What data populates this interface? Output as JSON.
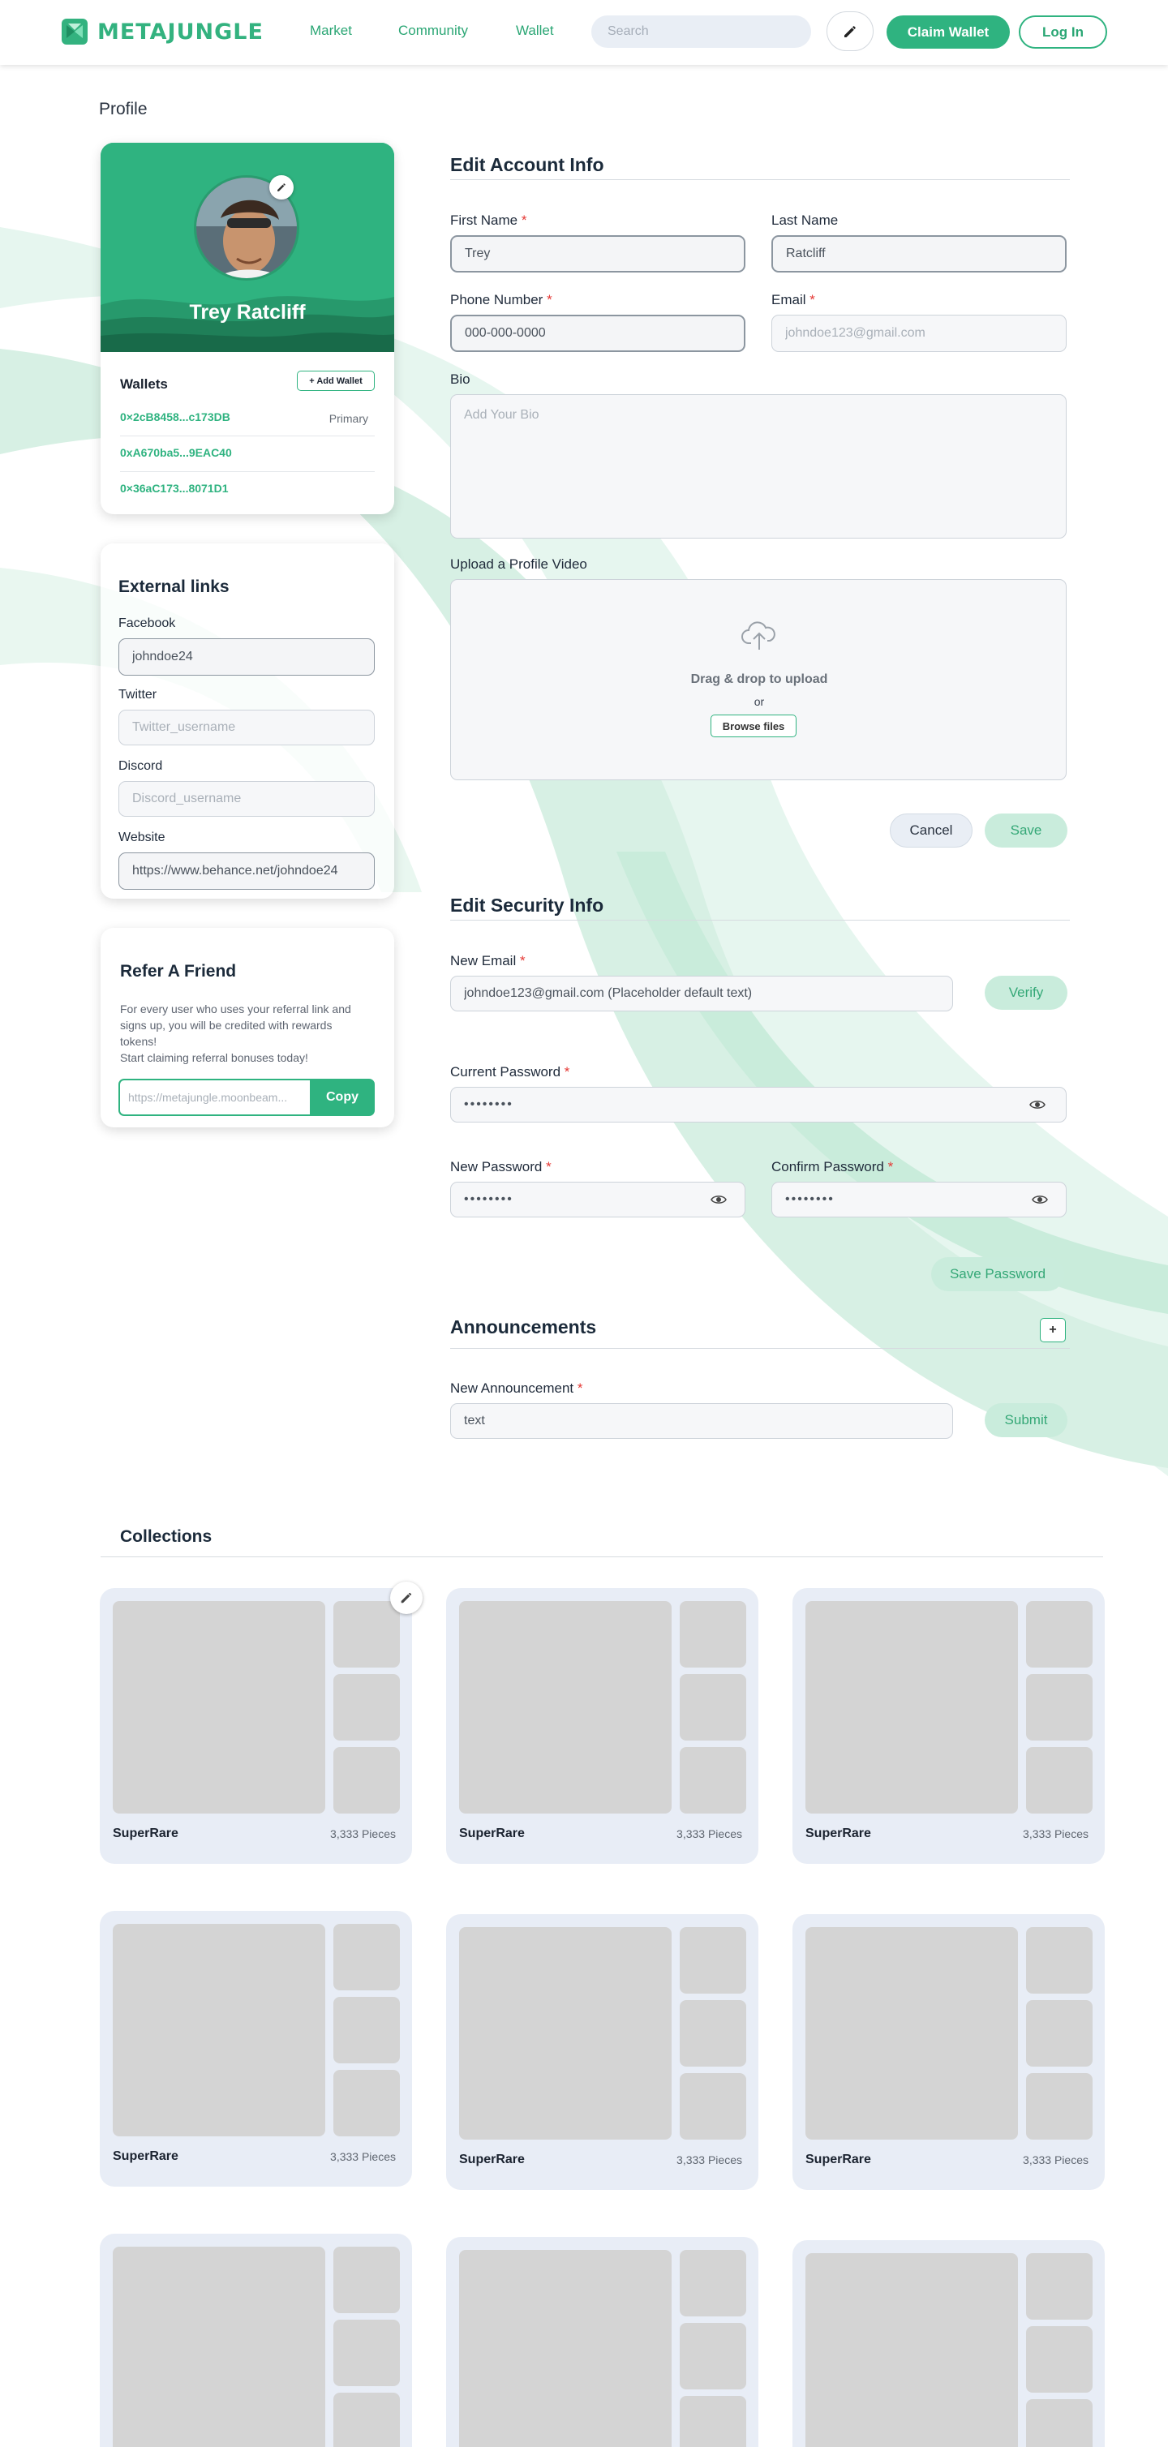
{
  "brand": {
    "name": "METAJUNGLE",
    "accent": "#2fb380"
  },
  "nav": {
    "links": [
      "Market",
      "Community",
      "Wallet"
    ],
    "search_placeholder": "Search",
    "edit_icon": "pencil-icon",
    "claim_label": "Claim Wallet",
    "login_label": "Log In"
  },
  "page": {
    "title": "Profile"
  },
  "profile": {
    "name": "Trey Ratcliff",
    "wallets_title": "Wallets",
    "add_wallet_label": "+ Add Wallet",
    "wallets": [
      {
        "address": "0×2cB8458...c173DB",
        "tag": "Primary"
      },
      {
        "address": "0xA670ba5...9EAC40",
        "tag": ""
      },
      {
        "address": "0×36aC173...8071D1",
        "tag": ""
      }
    ]
  },
  "external_links": {
    "title": "External links",
    "facebook": {
      "label": "Facebook",
      "value": "johndoe24",
      "placeholder": ""
    },
    "twitter": {
      "label": "Twitter",
      "value": "",
      "placeholder": "Twitter_username"
    },
    "discord": {
      "label": "Discord",
      "value": "",
      "placeholder": "Discord_username"
    },
    "website": {
      "label": "Website",
      "value": "https://www.behance.net/johndoe24",
      "placeholder": ""
    }
  },
  "refer": {
    "title": "Refer A Friend",
    "text": "For every user who uses your referral link and signs up, you will be credited with rewards tokens!\nStart claiming referral bonuses today!",
    "link_placeholder": "https://metajungle.moonbeam...",
    "copy_label": "Copy"
  },
  "account": {
    "title": "Edit Account Info",
    "first_name": {
      "label": "First Name",
      "value": "Trey"
    },
    "last_name": {
      "label": "Last Name",
      "value": "Ratcliff"
    },
    "phone": {
      "label": "Phone Number",
      "placeholder": "000-000-0000"
    },
    "email": {
      "label": "Email",
      "placeholder": "johndoe123@gmail.com"
    },
    "bio": {
      "label": "Bio",
      "placeholder": "Add Your Bio"
    },
    "video": {
      "label": "Upload a Profile Video",
      "drag_text": "Drag & drop to upload",
      "or_text": "or",
      "browse_label": "Browse files"
    },
    "cancel_label": "Cancel",
    "save_label": "Save"
  },
  "security": {
    "title": "Edit Security Info",
    "new_email": {
      "label": "New Email",
      "value": "johndoe123@gmail.com (Placeholder default text)"
    },
    "verify_label": "Verify",
    "current_password": {
      "label": "Current Password",
      "value": "••••••••"
    },
    "new_password": {
      "label": "New Password",
      "value": "••••••••"
    },
    "confirm_password": {
      "label": "Confirm Password",
      "value": "••••••••"
    },
    "save_password_label": "Save Password",
    "required_mark": "*"
  },
  "announcements": {
    "title": "Announcements",
    "add_label": "+",
    "new_label": "New Announcement",
    "value": "text",
    "submit_label": "Submit"
  },
  "collections": {
    "title": "Collections",
    "items": [
      {
        "name": "SuperRare",
        "count": "3,333 Pieces"
      },
      {
        "name": "SuperRare",
        "count": "3,333 Pieces"
      },
      {
        "name": "SuperRare",
        "count": "3,333 Pieces"
      },
      {
        "name": "SuperRare",
        "count": "3,333 Pieces"
      },
      {
        "name": "SuperRare",
        "count": "3,333 Pieces"
      },
      {
        "name": "SuperRare",
        "count": "3,333 Pieces"
      },
      {
        "name": "",
        "count": ""
      },
      {
        "name": "",
        "count": ""
      },
      {
        "name": "",
        "count": ""
      }
    ]
  }
}
